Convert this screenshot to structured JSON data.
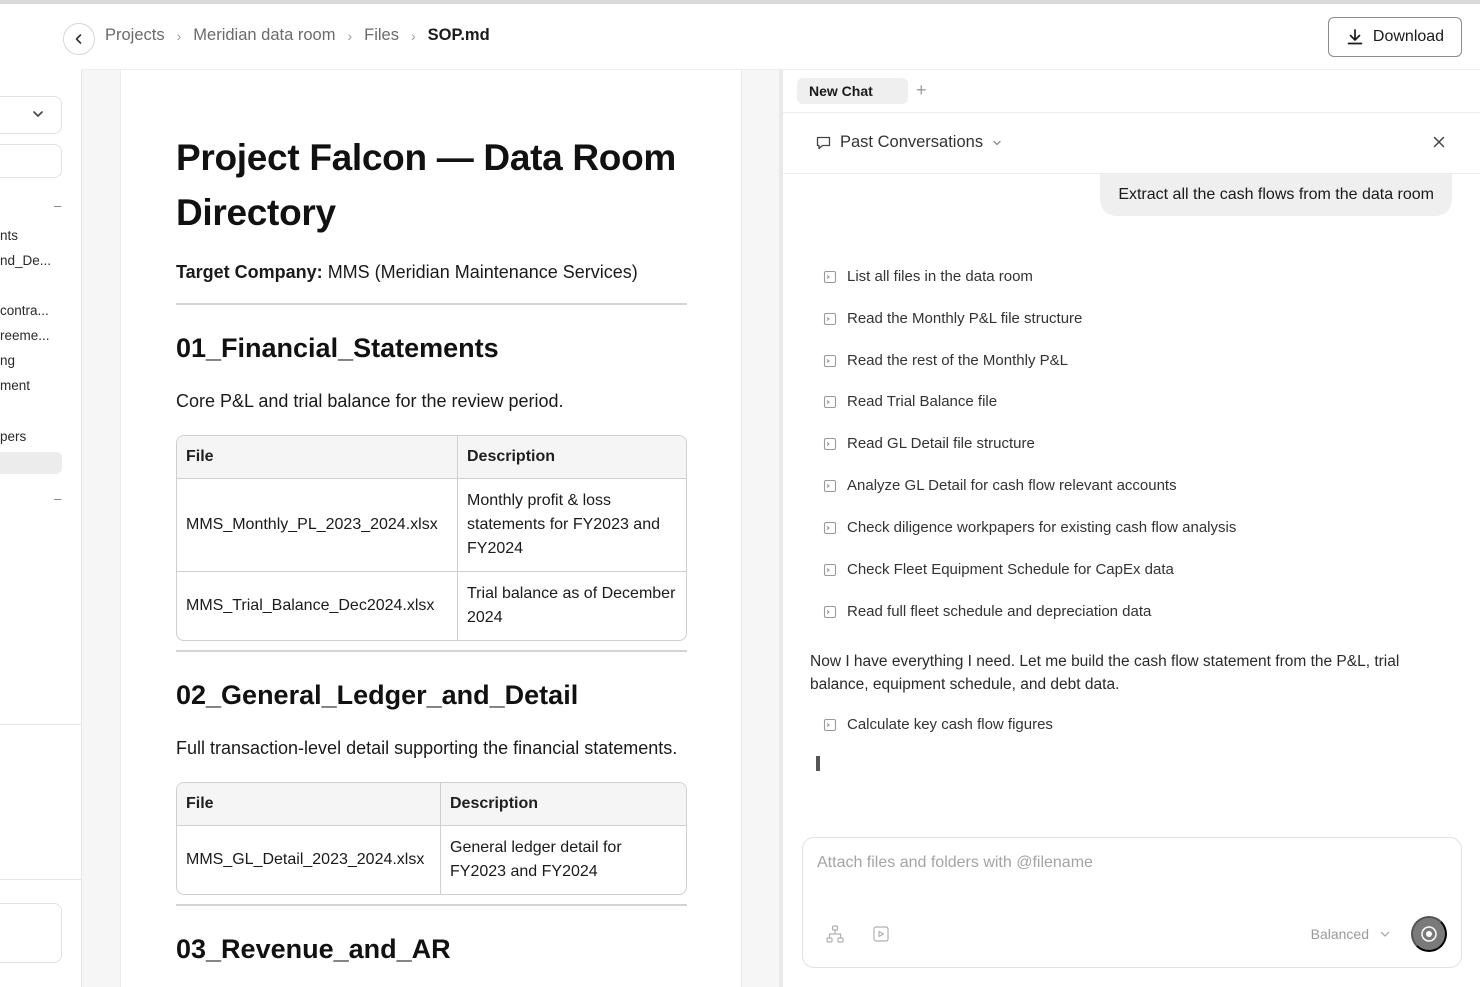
{
  "breadcrumb": {
    "items": [
      "Projects",
      "Meridian data room",
      "Files"
    ],
    "current": "SOP.md"
  },
  "header": {
    "download_label": "Download"
  },
  "sidebar": {
    "partial_items": [
      "nts",
      "nd_De...",
      "contra...",
      "reeme...",
      "ng",
      "ment",
      "pers"
    ],
    "dash": "–"
  },
  "document": {
    "title": "Project Falcon — Data Room Directory",
    "target_label": "Target Company:",
    "target_value": " MMS (Meridian Maintenance Services)",
    "sections": [
      {
        "heading": "01_Financial_Statements",
        "description": "Core P&L and trial balance for the review period.",
        "columns": [
          "File",
          "Description"
        ],
        "rows": [
          [
            "MMS_Monthly_PL_2023_2024.xlsx",
            "Monthly profit & loss statements for FY2023 and FY2024"
          ],
          [
            "MMS_Trial_Balance_Dec2024.xlsx",
            "Trial balance as of December 2024"
          ]
        ]
      },
      {
        "heading": "02_General_Ledger_and_Detail",
        "description": "Full transaction-level detail supporting the financial statements.",
        "columns": [
          "File",
          "Description"
        ],
        "rows": [
          [
            "MMS_GL_Detail_2023_2024.xlsx",
            "General ledger detail for FY2023 and FY2024"
          ]
        ]
      },
      {
        "heading": "03_Revenue_and_AR"
      }
    ]
  },
  "chat": {
    "tab_label": "New Chat",
    "add_tab": "+",
    "past_conversations_label": "Past Conversations",
    "user_message": "Extract all the cash flows from the data room",
    "steps": [
      "List all files in the data room",
      "Read the Monthly P&L file structure",
      "Read the rest of the Monthly P&L",
      "Read Trial Balance file",
      "Read GL Detail file structure",
      "Analyze GL Detail for cash flow relevant accounts",
      "Check diligence workpapers for existing cash flow analysis",
      "Check Fleet Equipment Schedule for CapEx data",
      "Read full fleet schedule and depreciation data"
    ],
    "assistant_text": "Now I have everything I need. Let me build the cash flow statement from the P&L, trial balance, equipment schedule, and debt data.",
    "final_step": "Calculate key cash flow figures",
    "input_placeholder": "Attach files and folders with @filename",
    "mode_label": "Balanced"
  },
  "colors": {
    "accent": "#1a1a1a",
    "send_button": "#7a7a7a",
    "border": "#cfcfcf"
  }
}
